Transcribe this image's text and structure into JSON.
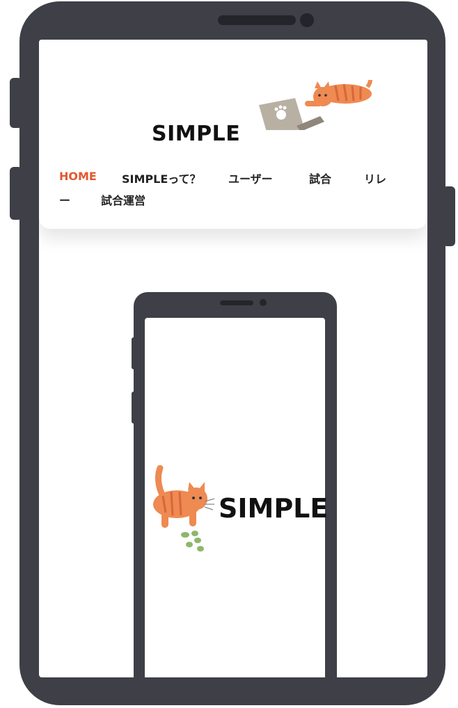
{
  "site": {
    "title": "SIMPLE"
  },
  "nav": {
    "items": [
      {
        "label": "HOME",
        "active": true
      },
      {
        "label": "SIMPLEって？",
        "active": false
      },
      {
        "label": "ユーザー",
        "active": false
      },
      {
        "label": "試合",
        "active": false
      },
      {
        "label": "リレ",
        "active": false
      },
      {
        "label": "ー",
        "active": false
      },
      {
        "label": "試合運営",
        "active": false
      }
    ]
  },
  "hero": {
    "logo_text": "SIMPLE"
  },
  "colors": {
    "accent": "#e4572e",
    "device_frame": "#3e3f47",
    "background": "#ffffff"
  },
  "icons": [
    "cat-laptop-icon",
    "cat-logo-icon"
  ]
}
